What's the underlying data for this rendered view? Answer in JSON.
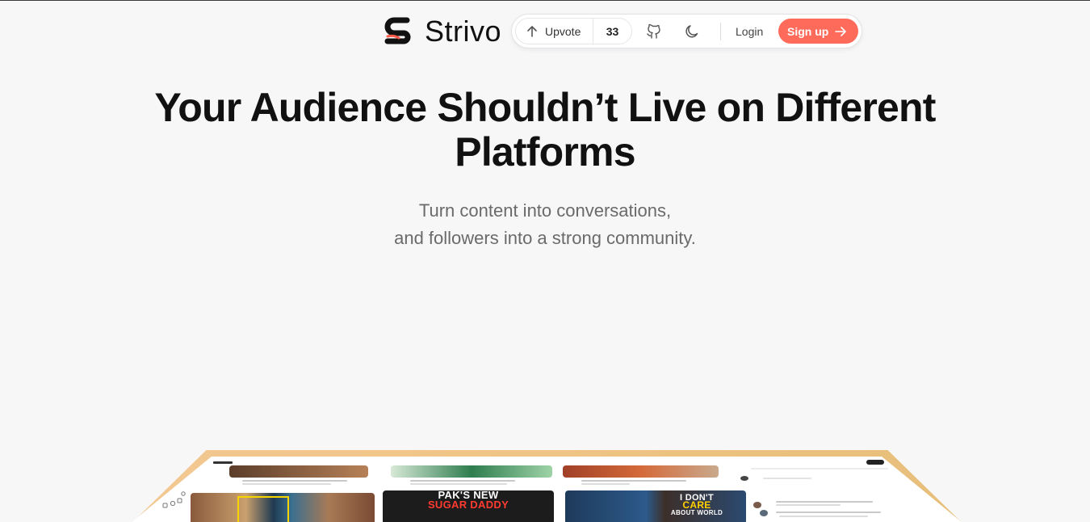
{
  "brand": {
    "name": "Strivo"
  },
  "nav": {
    "upvote_label": "Upvote",
    "upvote_count": "33",
    "login_label": "Login",
    "signup_label": "Sign up",
    "icons": [
      "arrow-up-icon",
      "github-icon",
      "moon-icon",
      "arrow-right-icon"
    ]
  },
  "hero": {
    "title": "Your Audience Shouldn’t Live on Different Platforms",
    "subtitle_line1": "Turn content into conversations,",
    "subtitle_line2": "and followers into a strong community."
  },
  "preview": {
    "card_overlays": [
      "PAK'S NEW",
      "SUGAR DADDY",
      "I DON'T",
      "CARE",
      "ABOUT WORLD"
    ]
  },
  "colors": {
    "accent": "#ff6b5b",
    "background": "#f7f7f8",
    "device_frame": "#f1c586"
  }
}
